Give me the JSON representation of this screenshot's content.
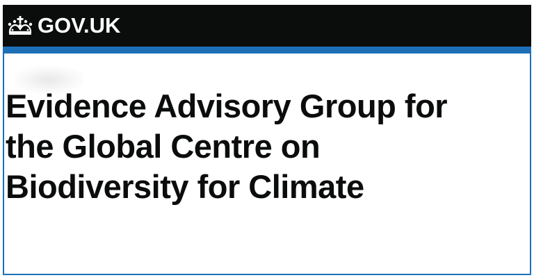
{
  "header": {
    "logo_icon": "crown-icon",
    "logo_text": "GOV.UK",
    "background_color": "#0b0c0c",
    "accent_color": "#1d70b8"
  },
  "main": {
    "title": "Evidence Advisory Group for\nthe Global Centre on\nBiodiversity for Climate"
  }
}
